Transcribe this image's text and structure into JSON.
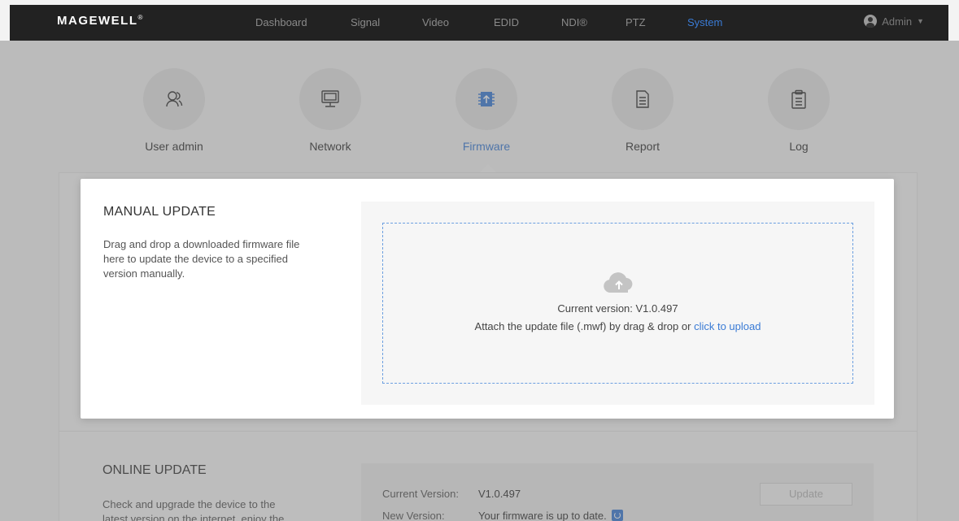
{
  "topbar": {
    "logo": "MAGEWELL",
    "logo_mark": "®",
    "nav": [
      "Dashboard",
      "Signal",
      "Video",
      "EDID",
      "NDI®",
      "PTZ",
      "System"
    ],
    "active_nav": "System",
    "user": "Admin"
  },
  "system_tabs": [
    {
      "label": "User admin",
      "icon": "user-icon"
    },
    {
      "label": "Network",
      "icon": "monitor-icon"
    },
    {
      "label": "Firmware",
      "icon": "chip-upload-icon"
    },
    {
      "label": "Report",
      "icon": "document-icon"
    },
    {
      "label": "Log",
      "icon": "clipboard-icon"
    }
  ],
  "active_tab": "Firmware",
  "manual_update": {
    "title": "MANUAL UPDATE",
    "description": "Drag and drop a downloaded firmware file here to update the device to a specified version manually.",
    "current_version": "Current version: V1.0.497",
    "hint_prefix": "Attach the update file (.mwf) by drag & drop or ",
    "upload_link": "click to upload"
  },
  "online_update": {
    "title": "ONLINE UPDATE",
    "description": "Check and upgrade the device to the latest version on the internet, enjoy the",
    "current_version_label": "Current Version:",
    "current_version_value": "V1.0.497",
    "new_version_label": "New Version:",
    "new_version_value": "Your firmware is up to date.",
    "update_button": "Update"
  },
  "colors": {
    "accent": "#3a7bd5",
    "topbar": "#222222",
    "overlay": "rgba(110,110,110,0.42)"
  }
}
